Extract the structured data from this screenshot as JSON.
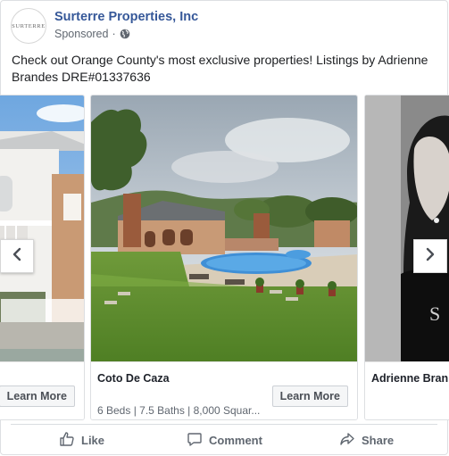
{
  "post": {
    "page_name": "Surterre Properties, Inc",
    "avatar_text": "SURTERRE",
    "sponsored_label": "Sponsored",
    "dot": "·",
    "text": "Check out Orange County's most exclusive properties! Listings by Adrienne Brandes DRE#01337636"
  },
  "carousel": {
    "cards": [
      {
        "title": "",
        "description": "",
        "cta": "Learn More"
      },
      {
        "title": "Coto De Caza",
        "description": "6 Beds | 7.5 Baths | 8,000 Squar...",
        "cta": "Learn More"
      },
      {
        "title": "Adrienne Bran",
        "description": "",
        "cta": ""
      }
    ]
  },
  "actions": {
    "like": "Like",
    "comment": "Comment",
    "share": "Share"
  },
  "colors": {
    "link_blue": "#365899",
    "secondary_text": "#606770",
    "border": "#dddfe2"
  },
  "icons": [
    "globe-icon",
    "chevron-left-icon",
    "chevron-right-icon",
    "thumbs-up-icon",
    "comment-icon",
    "share-icon"
  ]
}
